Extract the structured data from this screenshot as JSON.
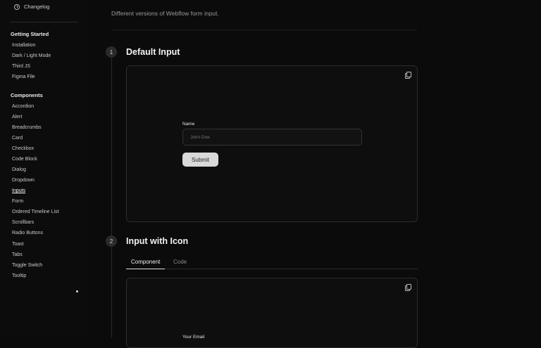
{
  "sidebar": {
    "changelog": "Changelog",
    "sections": [
      {
        "title": "Getting Started",
        "items": [
          "Installation",
          "Dark / Light Mode",
          "Third JS",
          "Figma File"
        ]
      },
      {
        "title": "Components",
        "items": [
          "Accordion",
          "Alert",
          "Breadcrumbs",
          "Card",
          "Checkbox",
          "Code Block",
          "Dialog",
          "Dropdown",
          "Inputs",
          "Form",
          "Ordered Timeline List",
          "Scrollbars",
          "Radio Buttons",
          "Toast",
          "Tabs",
          "Toggle Switch",
          "Tooltip"
        ]
      }
    ],
    "active_item": "Inputs"
  },
  "main": {
    "intro": "Different versions of Webflow form input.",
    "sections": [
      {
        "number": "1",
        "title": "Default Input",
        "field_label": "Name",
        "placeholder": "John Doe",
        "submit": "Submit"
      },
      {
        "number": "2",
        "title": "Input with Icon",
        "tabs": [
          "Component",
          "Code"
        ],
        "field_label": "Your Email"
      }
    ]
  },
  "colors": {
    "background": "#0b0b0b",
    "panel": "#0e0e0e",
    "button": "#d9d9d9"
  }
}
